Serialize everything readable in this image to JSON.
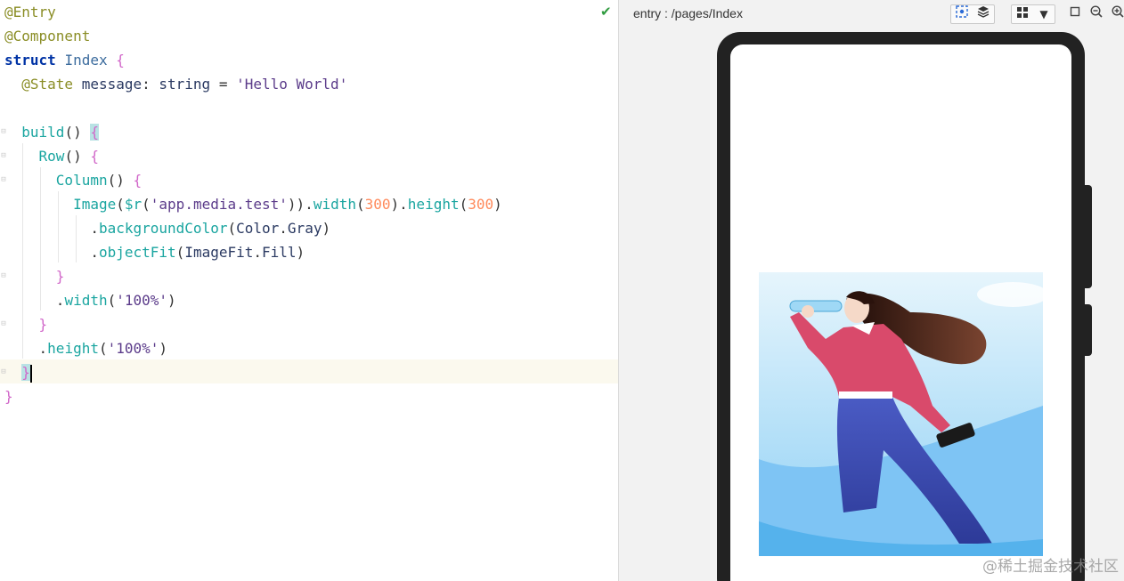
{
  "editor": {
    "lines": [
      {
        "segments": [
          {
            "t": "@Entry",
            "c": "c-anno"
          }
        ]
      },
      {
        "segments": [
          {
            "t": "@Component",
            "c": "c-anno"
          }
        ]
      },
      {
        "segments": [
          {
            "t": "struct",
            "c": "c-kw"
          },
          {
            "t": " ",
            "c": ""
          },
          {
            "t": "Index",
            "c": "c-type"
          },
          {
            "t": " ",
            "c": ""
          },
          {
            "t": "{",
            "c": "c-brace"
          }
        ]
      },
      {
        "segments": [
          {
            "t": "  ",
            "c": ""
          },
          {
            "t": "@State",
            "c": "c-anno"
          },
          {
            "t": " message",
            "c": "c-id"
          },
          {
            "t": ": ",
            "c": "c-pun"
          },
          {
            "t": "string",
            "c": "c-id"
          },
          {
            "t": " = ",
            "c": "c-pun"
          },
          {
            "t": "'Hello World'",
            "c": "c-str"
          }
        ]
      },
      {
        "segments": [
          {
            "t": "",
            "c": ""
          }
        ]
      },
      {
        "segments": [
          {
            "t": "  ",
            "c": ""
          },
          {
            "t": "build",
            "c": "c-fn"
          },
          {
            "t": "() ",
            "c": "c-pun"
          },
          {
            "t": "{",
            "c": "c-brace c-hl"
          }
        ]
      },
      {
        "segments": [
          {
            "t": "    ",
            "c": ""
          },
          {
            "t": "Row",
            "c": "c-fn"
          },
          {
            "t": "() ",
            "c": "c-pun"
          },
          {
            "t": "{",
            "c": "c-brace"
          }
        ]
      },
      {
        "segments": [
          {
            "t": "      ",
            "c": ""
          },
          {
            "t": "Column",
            "c": "c-fn"
          },
          {
            "t": "() ",
            "c": "c-pun"
          },
          {
            "t": "{",
            "c": "c-brace"
          }
        ]
      },
      {
        "segments": [
          {
            "t": "        ",
            "c": ""
          },
          {
            "t": "Image",
            "c": "c-fn"
          },
          {
            "t": "(",
            "c": "c-pun"
          },
          {
            "t": "$r",
            "c": "c-fn"
          },
          {
            "t": "(",
            "c": "c-pun"
          },
          {
            "t": "'app.media.test'",
            "c": "c-str"
          },
          {
            "t": ")).",
            "c": "c-pun"
          },
          {
            "t": "width",
            "c": "c-fn"
          },
          {
            "t": "(",
            "c": "c-pun"
          },
          {
            "t": "300",
            "c": "c-num"
          },
          {
            "t": ").",
            "c": "c-pun"
          },
          {
            "t": "height",
            "c": "c-fn"
          },
          {
            "t": "(",
            "c": "c-pun"
          },
          {
            "t": "300",
            "c": "c-num"
          },
          {
            "t": ")",
            "c": "c-pun"
          }
        ]
      },
      {
        "segments": [
          {
            "t": "          .",
            "c": "c-pun"
          },
          {
            "t": "backgroundColor",
            "c": "c-fn"
          },
          {
            "t": "(",
            "c": "c-pun"
          },
          {
            "t": "Color",
            "c": "c-id"
          },
          {
            "t": ".",
            "c": "c-pun"
          },
          {
            "t": "Gray",
            "c": "c-id"
          },
          {
            "t": ")",
            "c": "c-pun"
          }
        ]
      },
      {
        "segments": [
          {
            "t": "          .",
            "c": "c-pun"
          },
          {
            "t": "objectFit",
            "c": "c-fn"
          },
          {
            "t": "(",
            "c": "c-pun"
          },
          {
            "t": "ImageFit",
            "c": "c-id"
          },
          {
            "t": ".",
            "c": "c-pun"
          },
          {
            "t": "Fill",
            "c": "c-id"
          },
          {
            "t": ")",
            "c": "c-pun"
          }
        ]
      },
      {
        "segments": [
          {
            "t": "      ",
            "c": ""
          },
          {
            "t": "}",
            "c": "c-brace"
          }
        ]
      },
      {
        "segments": [
          {
            "t": "      .",
            "c": "c-pun"
          },
          {
            "t": "width",
            "c": "c-fn"
          },
          {
            "t": "(",
            "c": "c-pun"
          },
          {
            "t": "'100%'",
            "c": "c-str"
          },
          {
            "t": ")",
            "c": "c-pun"
          }
        ]
      },
      {
        "segments": [
          {
            "t": "    ",
            "c": ""
          },
          {
            "t": "}",
            "c": "c-brace"
          }
        ]
      },
      {
        "segments": [
          {
            "t": "    .",
            "c": "c-pun"
          },
          {
            "t": "height",
            "c": "c-fn"
          },
          {
            "t": "(",
            "c": "c-pun"
          },
          {
            "t": "'100%'",
            "c": "c-str"
          },
          {
            "t": ")",
            "c": "c-pun"
          }
        ]
      },
      {
        "segments": [
          {
            "t": "  ",
            "c": ""
          },
          {
            "t": "}",
            "c": "c-brace c-hl"
          }
        ]
      },
      {
        "segments": [
          {
            "t": "}",
            "c": "c-brace"
          }
        ]
      }
    ]
  },
  "previewer": {
    "title": "entry : /pages/Index"
  },
  "watermark": "@稀土掘金技术社区",
  "colors": {
    "sky_top": "#dff2fb",
    "sky_bottom": "#8fd0f5",
    "hill": "#5bb8f0",
    "sweater": "#d94a6b",
    "pants": "#3e4db0",
    "hair": "#3a1a14"
  }
}
